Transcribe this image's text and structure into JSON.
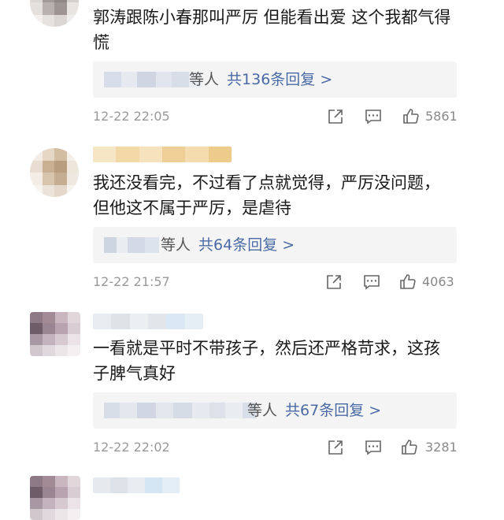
{
  "comments": [
    {
      "text_line1": "郭涛跟陈小春那叫严厉 但能看出爱 这个我都气得",
      "text_line2": "慌",
      "reply_who": "等人",
      "reply_summary": "共136条回复 >",
      "time": "12-22 22:05",
      "likes": "5861",
      "avatar_colors": [
        "#d9d4d0",
        "#c7c0bc",
        "#b0a8a6",
        "#e7e3e1",
        "#ded8d5",
        "#a39a97",
        "#8f8783",
        "#d4cfcc",
        "#e4e0de",
        "#b9b1ad",
        "#9e9592",
        "#e8e4e2",
        "#f2efee",
        "#e6e2e0",
        "#dbd6d3",
        "#efeceb"
      ]
    },
    {
      "text_line1": "我还没看完，不过看了点就觉得，严厉没问题，",
      "text_line2": "但他这不属于严厉，是虐待",
      "reply_who": "等人",
      "reply_summary": "共64条回复 >",
      "time": "12-22 21:57",
      "likes": "4063",
      "avatar_colors": [
        "#f1ece6",
        "#e6d7c4",
        "#d2bda0",
        "#f4efe9",
        "#e8ddd0",
        "#c9b092",
        "#b89e7f",
        "#efe6db",
        "#f3ede6",
        "#d8c5ad",
        "#c4ad91",
        "#efe8e0",
        "#f7f4f0",
        "#ece4da",
        "#e4d8ca",
        "#f6f2ee"
      ]
    },
    {
      "text_line1": "一看就是平时不带孩子，然后还严格苛求，这孩",
      "text_line2": "子脾气真好",
      "reply_who": "等人",
      "reply_summary": "共67条回复 >",
      "time": "12-22 22:02",
      "likes": "3281",
      "avatar_colors": [
        "#8d7a86",
        "#a38b96",
        "#c9b6bf",
        "#e2d6db",
        "#6e5c69",
        "#9a8692",
        "#b8a3ae",
        "#d9ccd2",
        "#a898a4",
        "#c2b3bd",
        "#d6cad0",
        "#ebe3e7",
        "#d1c7cd",
        "#e0d8dc",
        "#ece6e9",
        "#f4f0f2"
      ]
    }
  ],
  "colors": {
    "reply_link": "#4a6aa5",
    "reply_bg": "#f4f4f4",
    "meta_gray": "#999999"
  },
  "icons": [
    "share-icon",
    "comment-icon",
    "like-icon"
  ]
}
